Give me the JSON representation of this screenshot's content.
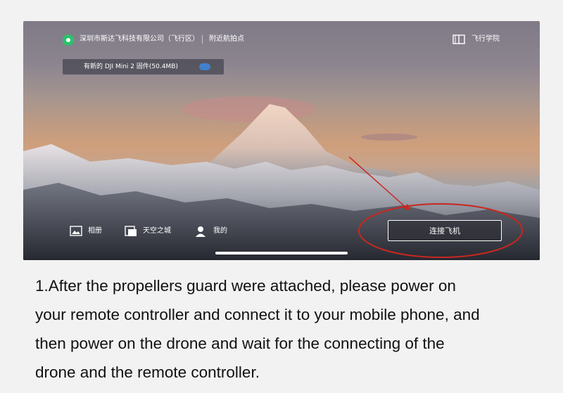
{
  "header": {
    "location": "深圳市斯达飞科技有限公司（飞行区）",
    "nearby_spots": "附近航拍点",
    "academy": "飞行学院"
  },
  "firmware": {
    "notice": "有新的 DJI Mini 2 固件(50.4MB)"
  },
  "bottom_nav": {
    "album": "相册",
    "skypixel": "天空之城",
    "me": "我的",
    "connect_button": "连接飞机"
  },
  "colors": {
    "location_pin": "#29c36a",
    "annotation": "#c8271f"
  },
  "caption": {
    "text": "1.After the propellers guard were attached, please power on\nyour remote controller and connect it to your mobile phone, and\nthen power on the drone and wait for the connecting of the\ndrone and the remote controller."
  }
}
